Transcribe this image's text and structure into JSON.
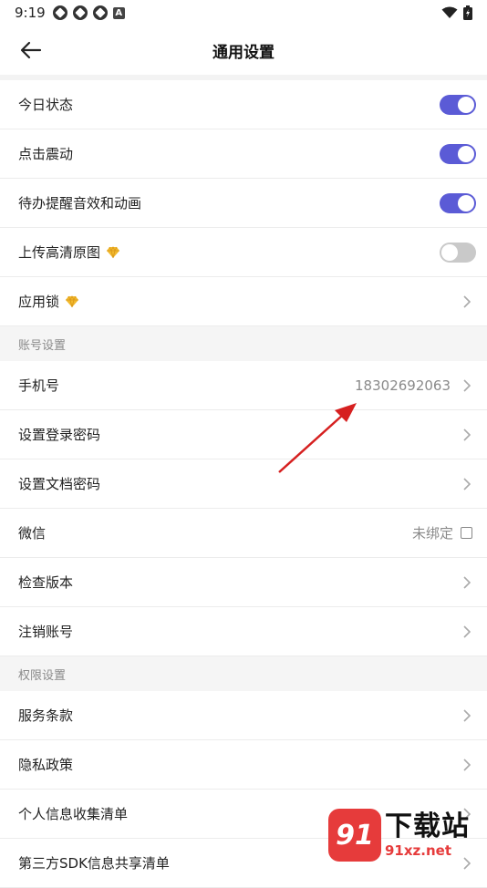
{
  "status_bar": {
    "time": "9:19"
  },
  "app_bar": {
    "title": "通用设置"
  },
  "toggle_rows": [
    {
      "label": "今日状态",
      "state": "on"
    },
    {
      "label": "点击震动",
      "state": "on"
    },
    {
      "label": "待办提醒音效和动画",
      "state": "on"
    },
    {
      "label": "上传高清原图",
      "state": "off",
      "premium": true
    }
  ],
  "app_lock": {
    "label": "应用锁",
    "premium": true
  },
  "account_section": {
    "header": "账号设置",
    "phone": {
      "label": "手机号",
      "value": "18302692063"
    },
    "login_password": {
      "label": "设置登录密码"
    },
    "doc_password": {
      "label": "设置文档密码"
    },
    "wechat": {
      "label": "微信",
      "value": "未绑定"
    },
    "check_version": {
      "label": "检查版本"
    },
    "cancel_account": {
      "label": "注销账号"
    }
  },
  "permission_section": {
    "header": "权限设置",
    "terms": {
      "label": "服务条款"
    },
    "privacy": {
      "label": "隐私政策"
    },
    "personal_info": {
      "label": "个人信息收集清单"
    },
    "third_party": {
      "label": "第三方SDK信息共享清单"
    }
  },
  "watermark": {
    "badge": "91",
    "main": "下载站",
    "sub": "91xz.net"
  },
  "colors": {
    "accent": "#5b5bd6",
    "toggle_off": "#c9c9c9",
    "arrow": "#d62020",
    "watermark_red": "#e63b3b"
  }
}
